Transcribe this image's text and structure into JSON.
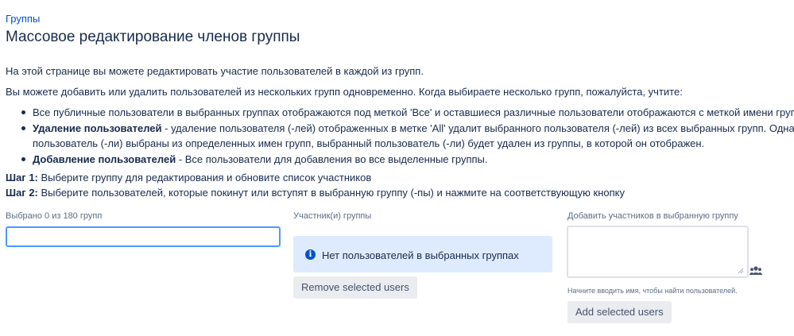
{
  "breadcrumb": "Группы",
  "page_title": "Массовое редактирование членов группы",
  "intro_1": "На этой странице вы можете редактировать участие пользователей в каждой из групп.",
  "intro_2": "Вы можете добавить или удалить пользователей из нескольких групп одновременно. Когда выбираете несколько групп, пожалуйста, учтите:",
  "bullets": [
    {
      "bold": "",
      "text": "Все публичные пользователи в выбранных группах отображаются под меткой 'Все' и оставшиеся различные пользователи отображаются с меткой имени группы."
    },
    {
      "bold": "Удаление пользователей",
      "text": " - удаление пользователя (-лей) отображенных в метке 'All' удалит выбранного пользователя (-лей) из всех выбранных групп. Однако, есл",
      "text_2": "пользователь (-ли) выбраны из определенных имен групп, выбранный пользователь (-ли) будет удален из группы, в которой он отображен."
    },
    {
      "bold": "Добавление пользователей",
      "text": " - Все пользователи для добавления во все выделенные группы."
    }
  ],
  "step_1": {
    "label": "Шаг 1:",
    "text": " Выберите группу для редактирования и обновите список участников"
  },
  "step_2": {
    "label": "Шаг 2:",
    "text": " Выберите пользователей, которые покинут или вступят в выбранную группу (-пы) и нажмите на соответствующую кнопку"
  },
  "groups_column": {
    "label": "Выбрано 0 из 180 групп",
    "input_value": ""
  },
  "members_column": {
    "label": "Участник(и) группы",
    "info_message": "Нет пользователей в выбранных группах",
    "remove_button": "Remove selected users"
  },
  "add_column": {
    "label": "Добавить участников в выбранную группу",
    "textarea_value": "",
    "hint": "Начните вводить имя, чтобы найти пользователей.",
    "add_button": "Add selected users"
  },
  "icons": {
    "info": "info-icon",
    "users": "users-icon"
  },
  "colors": {
    "link": "#0052cc",
    "focus_border": "#4c9aff",
    "info_bg": "#deebff",
    "button_bg": "#ebecf0",
    "text": "#172b4d"
  }
}
